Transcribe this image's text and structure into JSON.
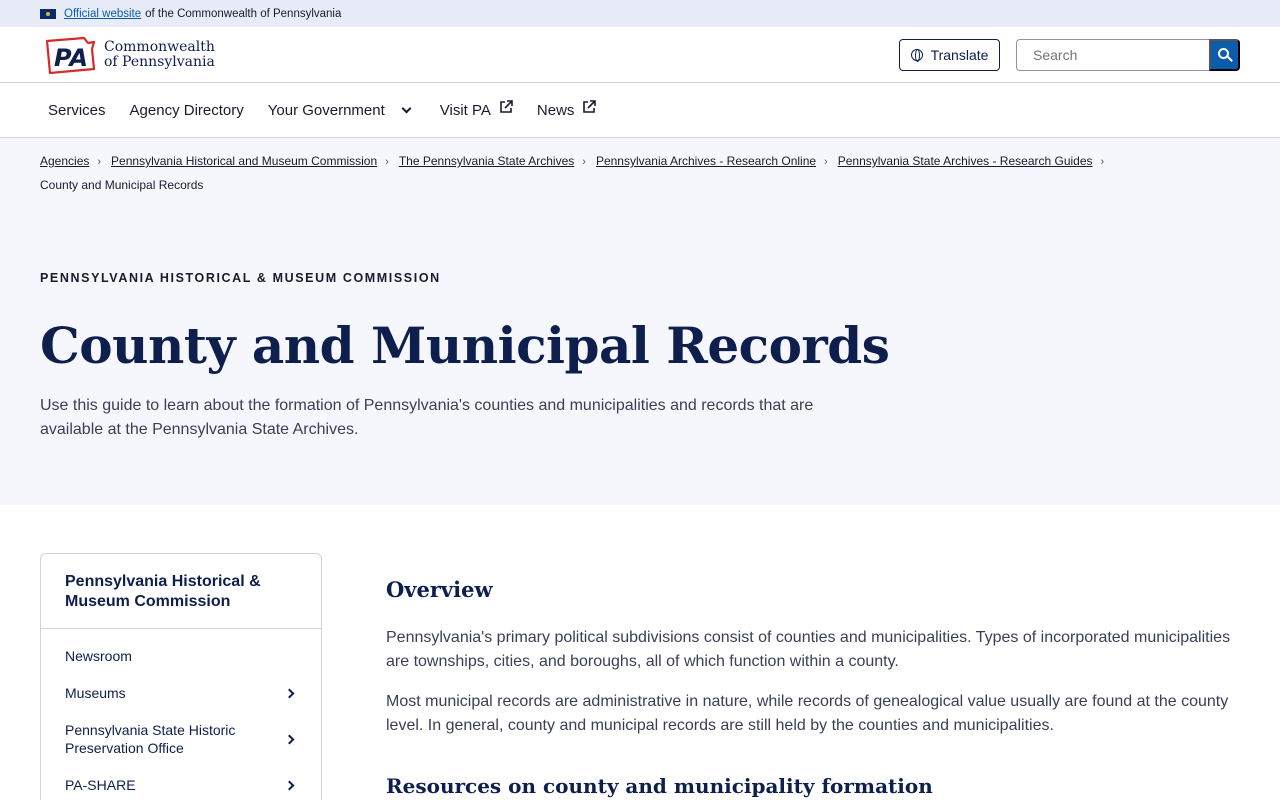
{
  "official_bar": {
    "link_text": "Official website",
    "rest_text": "of the Commonwealth of Pennsylvania"
  },
  "header": {
    "logo_text": "PA",
    "brand_line1": "Commonwealth",
    "brand_line2": "of Pennsylvania",
    "translate_label": "Translate",
    "search_placeholder": "Search"
  },
  "nav": {
    "items": [
      {
        "label": "Services"
      },
      {
        "label": "Agency Directory"
      },
      {
        "label": "Your Government"
      },
      {
        "label": "Visit PA"
      },
      {
        "label": "News"
      }
    ]
  },
  "breadcrumb": {
    "items": [
      "Agencies",
      "Pennsylvania Historical and Museum Commission",
      "The Pennsylvania State Archives",
      "Pennsylvania Archives - Research Online",
      "Pennsylvania State Archives - Research Guides"
    ],
    "current": "County and Municipal Records"
  },
  "hero": {
    "eyebrow": "PENNSYLVANIA HISTORICAL & MUSEUM COMMISSION",
    "title": "County and Municipal Records",
    "intro": "Use this guide to learn about the formation of Pennsylvania's counties and municipalities and records that are available at the Pennsylvania State Archives."
  },
  "sidebar": {
    "title": "Pennsylvania Historical & Museum Commission",
    "items": [
      {
        "label": "Newsroom"
      },
      {
        "label": "Museums"
      },
      {
        "label": "Pennsylvania State Historic Preservation Office"
      },
      {
        "label": "PA-SHARE"
      }
    ]
  },
  "main": {
    "heading": "Overview",
    "paragraphs": [
      "Pennsylvania's primary political subdivisions consist of counties and municipalities. Types of incorporated municipalities are townships, cities, and boroughs, all of which function within a county.",
      "Most municipal records are administrative in nature, while records of genealogical value usually are found at the county level. In general, county and municipal records are still held by the counties and municipalities."
    ],
    "subheading": "Resources on county and municipality formation"
  },
  "colors": {
    "navy": "#0e1e4d",
    "link_blue": "#0b5cab",
    "logo_red": "#d62b2b",
    "hero_bg": "#f6f7fc",
    "official_bar_bg": "#e8ecf8"
  }
}
